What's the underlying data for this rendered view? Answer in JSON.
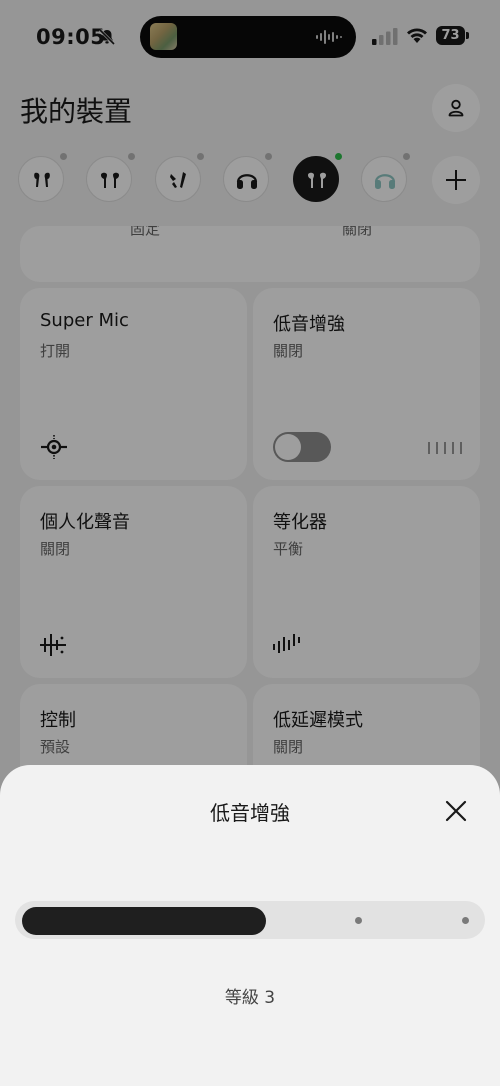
{
  "status": {
    "time": "09:05",
    "battery": "73"
  },
  "header": {
    "title": "我的裝置"
  },
  "devices": [
    {
      "name": "earbuds-1",
      "active": false
    },
    {
      "name": "earbuds-2",
      "active": false
    },
    {
      "name": "earbuds-3",
      "active": false
    },
    {
      "name": "headphones",
      "active": false
    },
    {
      "name": "earbuds-current",
      "active": true
    },
    {
      "name": "headphones-teal",
      "active": false
    }
  ],
  "partial_card": {
    "left_label": "固定",
    "right_label": "關閉"
  },
  "cards": [
    {
      "title": "Super Mic",
      "status": "打開",
      "icon": "super-mic-icon"
    },
    {
      "title": "低音增強",
      "status": "關閉",
      "icon": "toggle"
    },
    {
      "title": "個人化聲音",
      "status": "關閉",
      "icon": "personalized-sound-icon"
    },
    {
      "title": "等化器",
      "status": "平衡",
      "icon": "equalizer-icon"
    },
    {
      "title": "控制",
      "status": "預設"
    },
    {
      "title": "低延遲模式",
      "status": "關閉"
    }
  ],
  "sheet": {
    "title": "低音增強",
    "level_text": "等級 3",
    "level": 3,
    "level_max": 5
  },
  "colors": {
    "active_dot": "#2fbf4d",
    "slider_fill": "#1f1f1f",
    "page_bg": "#f2f2f2"
  }
}
